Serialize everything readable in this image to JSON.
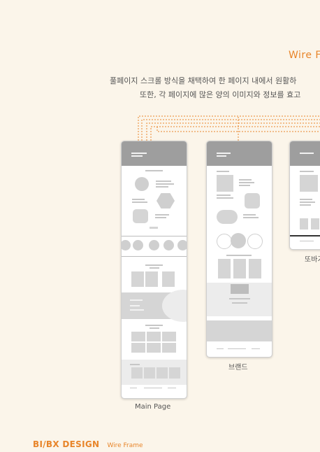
{
  "title": "Wire F",
  "description": {
    "line1": "풀페이지 스크롤 방식을 채택하여 한 페이지 내에서 원활하",
    "line2": "또한, 각 페이지에 많은 양의 이미지와 정보를 효고"
  },
  "frames": [
    {
      "caption": "Main Page"
    },
    {
      "caption": "브랜드"
    },
    {
      "caption": "또바기"
    }
  ],
  "footer": {
    "brand": "BI/BX DESIGN",
    "section": "Wire Frame"
  },
  "colors": {
    "accent": "#e8852a",
    "background": "#fbf5ea"
  }
}
